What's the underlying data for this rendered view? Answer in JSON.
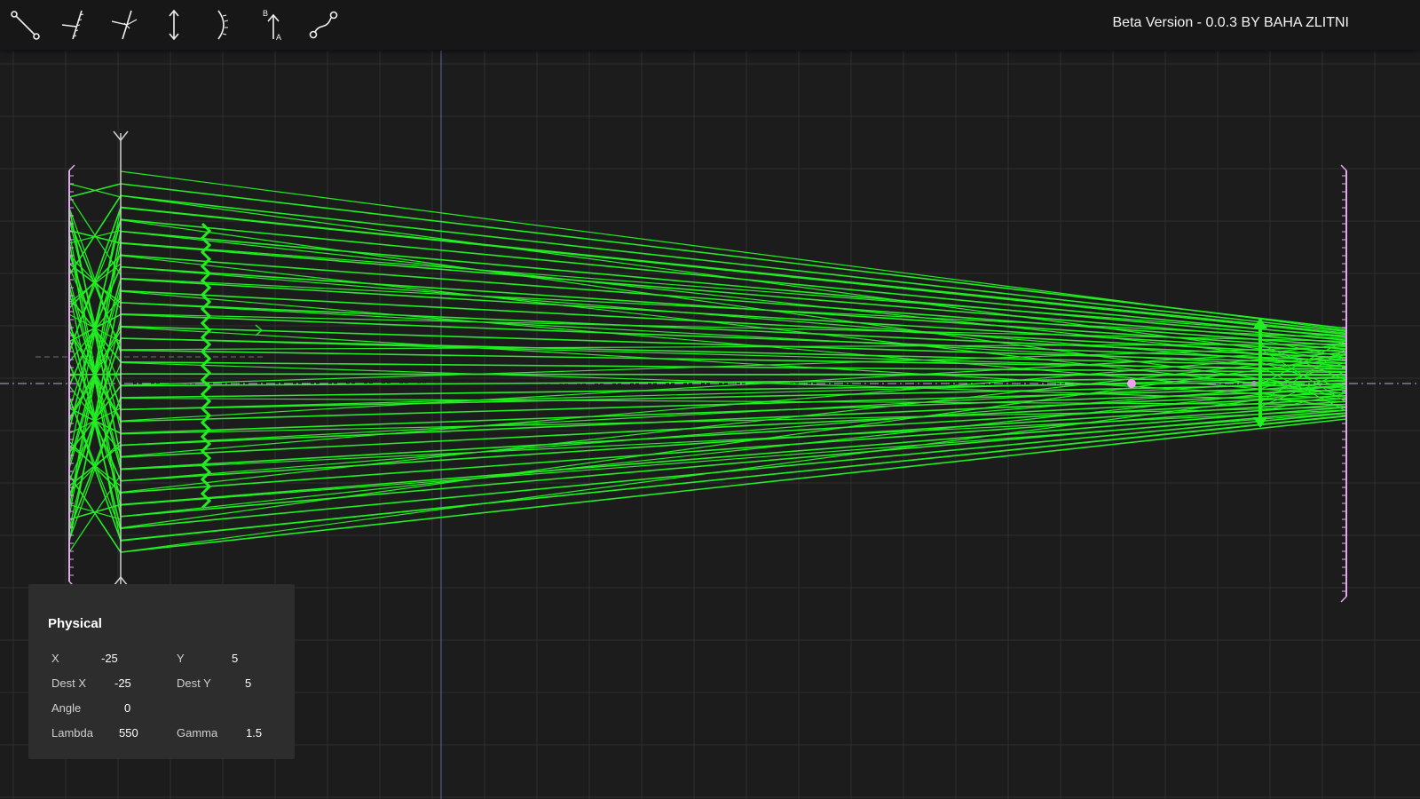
{
  "app": {
    "version_text": "Beta Version - 0.0.3 BY BAHA ZLITNI"
  },
  "toolbar": {
    "tools": [
      {
        "id": "ray",
        "icon": "ray-source-icon"
      },
      {
        "id": "plane-mirror",
        "icon": "plane-mirror-icon"
      },
      {
        "id": "beam-splitter",
        "icon": "beam-splitter-icon"
      },
      {
        "id": "lens",
        "icon": "double-arrow-lens-icon"
      },
      {
        "id": "curved-mirror",
        "icon": "curved-mirror-icon"
      },
      {
        "id": "object",
        "icon": "object-arrow-icon"
      },
      {
        "id": "path",
        "icon": "path-curve-icon"
      }
    ],
    "object_icon_letters": {
      "top": "B",
      "bottom": "A"
    }
  },
  "panel": {
    "title": "Physical",
    "fields": {
      "x": {
        "label": "X",
        "value": "-25"
      },
      "y": {
        "label": "Y",
        "value": "5"
      },
      "dest_x": {
        "label": "Dest X",
        "value": "-25"
      },
      "dest_y": {
        "label": "Dest Y",
        "value": "5"
      },
      "angle": {
        "label": "Angle",
        "value": "0"
      },
      "lambda": {
        "label": "Lambda",
        "value": "550"
      },
      "gamma": {
        "label": "Gamma",
        "value": "1.5"
      }
    }
  },
  "scene": {
    "colors": {
      "background": "#1c1c1d",
      "grid": "#2e2e30",
      "ray": "#22ee22",
      "mirror": "#e7a6f0",
      "lens": "#cfcfcf",
      "axis": "#9aa6c8",
      "focal_point": "#f0a0f0"
    },
    "ray_bundle": {
      "ray_count": 32,
      "left_mirror_span": [
        -20,
        20
      ],
      "lens_span": [
        -21,
        21
      ],
      "right_mirror_span": [
        -5,
        5
      ]
    }
  }
}
